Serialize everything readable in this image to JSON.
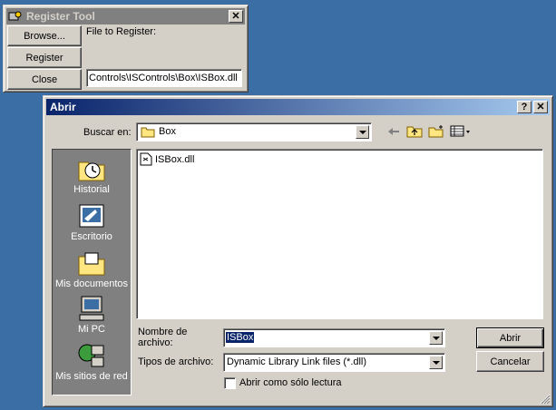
{
  "register_tool": {
    "title": "Register Tool",
    "browse_label": "Browse...",
    "register_label": "Register",
    "close_label": "Close",
    "file_label": "File to Register:",
    "file_path": "Controls\\ISControls\\Box\\ISBox.dll",
    "close_glyph": "✕"
  },
  "open_dialog": {
    "title": "Abrir",
    "help_glyph": "?",
    "close_glyph": "✕",
    "look_in_label": "Buscar en:",
    "look_in_value": "Box",
    "places": [
      {
        "label": "Historial"
      },
      {
        "label": "Escritorio"
      },
      {
        "label": "Mis documentos"
      },
      {
        "label": "Mi PC"
      },
      {
        "label": "Mis sitios de red"
      }
    ],
    "files": [
      {
        "name": "ISBox.dll"
      }
    ],
    "filename_label_1": "Nombre de",
    "filename_label_2": "archivo:",
    "filename_value": "ISBox",
    "filetype_label": "Tipos de archivo:",
    "filetype_value": "Dynamic Library Link files (*.dll)",
    "readonly_label": "Abrir como sólo lectura",
    "open_button": "Abrir",
    "cancel_button": "Cancelar"
  },
  "colors": {
    "desktop": "#3a6ea5",
    "active_title": "#0a246a",
    "inactive_title": "#808080",
    "face": "#d4d0c8",
    "selection": "#0a246a"
  }
}
